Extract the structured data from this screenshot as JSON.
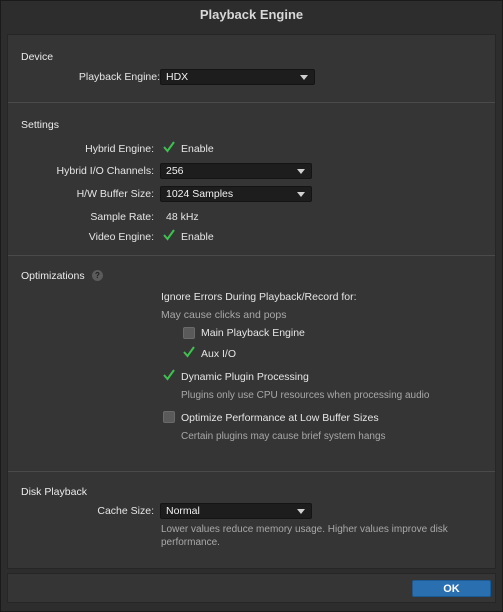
{
  "window": {
    "title": "Playback Engine"
  },
  "device": {
    "section_title": "Device",
    "playback_engine_label": "Playback Engine:",
    "playback_engine_value": "HDX"
  },
  "settings": {
    "section_title": "Settings",
    "hybrid_engine_label": "Hybrid Engine:",
    "hybrid_engine_checked": true,
    "hybrid_engine_option": "Enable",
    "hybrid_io_label": "Hybrid I/O Channels:",
    "hybrid_io_value": "256",
    "buffer_label": "H/W Buffer Size:",
    "buffer_value": "1024 Samples",
    "sample_rate_label": "Sample Rate:",
    "sample_rate_value": "48 kHz",
    "video_engine_label": "Video Engine:",
    "video_engine_checked": true,
    "video_engine_option": "Enable"
  },
  "optimizations": {
    "section_title": "Optimizations",
    "help_icon": "?",
    "ignore_errors_heading": "Ignore Errors During Playback/Record for:",
    "ignore_errors_note": "May cause clicks and pops",
    "main_playback_label": "Main Playback Engine",
    "main_playback_checked": false,
    "aux_io_label": "Aux I/O",
    "aux_io_checked": true,
    "dynamic_plugin_label": "Dynamic Plugin Processing",
    "dynamic_plugin_checked": true,
    "dynamic_plugin_note": "Plugins only use CPU resources when processing audio",
    "optimize_perf_label": "Optimize Performance at Low Buffer Sizes",
    "optimize_perf_checked": false,
    "optimize_perf_note": "Certain plugins may cause brief system hangs"
  },
  "disk_playback": {
    "section_title": "Disk Playback",
    "cache_size_label": "Cache Size:",
    "cache_size_value": "Normal",
    "note_line1": "Lower values reduce memory usage. Higher values improve disk",
    "note_line2": "performance."
  },
  "footer": {
    "ok_label": "OK"
  },
  "colors": {
    "accent": "#2a6fb0",
    "check": "#3fbf4f",
    "panel": "#353535"
  }
}
